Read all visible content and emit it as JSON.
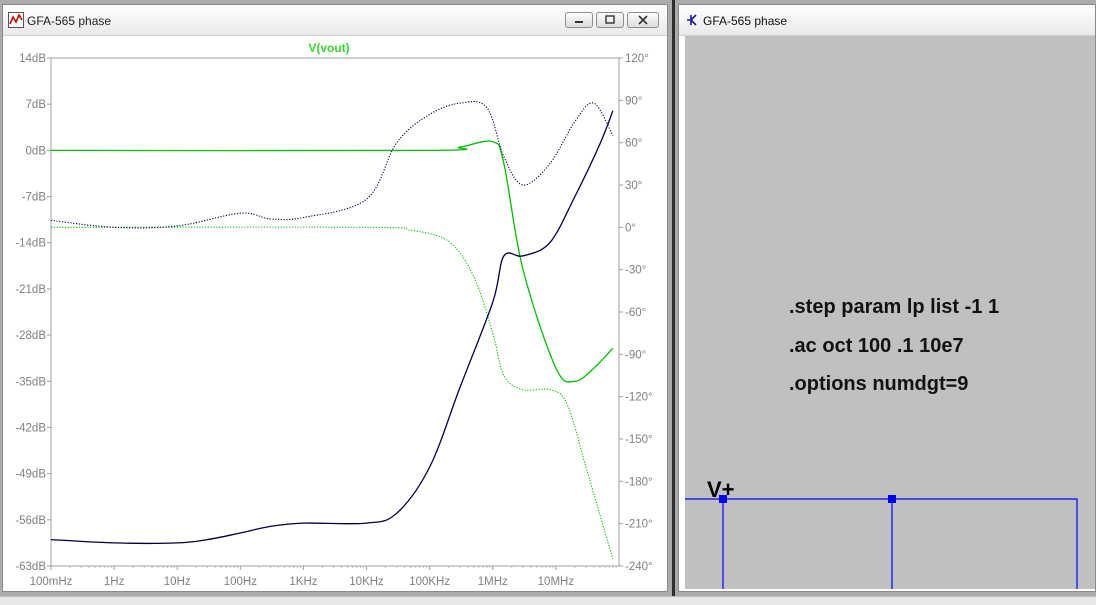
{
  "plot_window": {
    "title": "GFA-565 phase",
    "trace_label": "V(vout)",
    "icon": "waveform-plot-icon",
    "buttons": [
      "minimize-icon",
      "restore-icon",
      "close-icon"
    ]
  },
  "schematic_window": {
    "title": "GFA-565 phase",
    "icon": "schematic-icon",
    "directives": [
      ".step param lp list -1 1",
      ".ac oct 100 .1 10e7",
      ".options numdgt=9"
    ],
    "net_label": "V+"
  },
  "colors": {
    "green_trace": "#00c000",
    "dark_trace": "#000040",
    "axis_text": "#808080",
    "trace_label": "#33dd33",
    "schematic_bg": "#c0c0c0",
    "wire": "#0000ff"
  },
  "chart_data": {
    "type": "line",
    "title": "V(vout)",
    "x_scale": "log",
    "xlim": [
      0.1,
      100000000
    ],
    "x_ticks": [
      "100mHz",
      "1Hz",
      "10Hz",
      "100Hz",
      "1KHz",
      "10KHz",
      "100KHz",
      "1MHz",
      "10MHz"
    ],
    "y_left_ticks": [
      "14dB",
      "7dB",
      "0dB",
      "-7dB",
      "-14dB",
      "-21dB",
      "-28dB",
      "-35dB",
      "-42dB",
      "-49dB",
      "-56dB",
      "-63dB"
    ],
    "y_left_range": [
      -63,
      14
    ],
    "y_right_ticks": [
      "120°",
      "90°",
      "60°",
      "30°",
      "0°",
      "-30°",
      "-60°",
      "-90°",
      "-120°",
      "-150°",
      "-180°",
      "-210°",
      "-240°"
    ],
    "y_right_range": [
      -240,
      120
    ],
    "grid": false,
    "series": [
      {
        "axis": "left",
        "color": "#00c000",
        "style": "solid",
        "points": [
          [
            0.1,
            0
          ],
          [
            100000,
            0
          ],
          [
            300000,
            0.5
          ],
          [
            1000000,
            1.3
          ],
          [
            1500000,
            -2
          ],
          [
            3000000,
            -18
          ],
          [
            10000000,
            -33
          ],
          [
            20000000,
            -35
          ],
          [
            40000000,
            -33
          ],
          [
            80000000,
            -30
          ]
        ]
      },
      {
        "axis": "right",
        "color": "#00c000",
        "style": "dotted",
        "points": [
          [
            0.1,
            0
          ],
          [
            10000,
            0
          ],
          [
            50000,
            -2
          ],
          [
            200000,
            -10
          ],
          [
            500000,
            -35
          ],
          [
            1000000,
            -75
          ],
          [
            1500000,
            -105
          ],
          [
            3000000,
            -115
          ],
          [
            8000000,
            -115
          ],
          [
            15000000,
            -125
          ],
          [
            30000000,
            -170
          ],
          [
            80000000,
            -235
          ]
        ]
      },
      {
        "axis": "left",
        "color": "#000040",
        "style": "solid",
        "points": [
          [
            0.1,
            -59
          ],
          [
            1,
            -59.5
          ],
          [
            10,
            -59.5
          ],
          [
            30,
            -59
          ],
          [
            100,
            -58
          ],
          [
            300,
            -57
          ],
          [
            1000,
            -56.5
          ],
          [
            10000,
            -56.5
          ],
          [
            30000,
            -55
          ],
          [
            100000,
            -48
          ],
          [
            300000,
            -36
          ],
          [
            1000000,
            -23
          ],
          [
            1500000,
            -16
          ],
          [
            3000000,
            -16
          ],
          [
            8000000,
            -14
          ],
          [
            20000000,
            -7
          ],
          [
            50000000,
            1
          ],
          [
            80000000,
            6
          ]
        ]
      },
      {
        "axis": "right",
        "color": "#000040",
        "style": "dotted",
        "points": [
          [
            0.1,
            5
          ],
          [
            1,
            0
          ],
          [
            10,
            1
          ],
          [
            100,
            10
          ],
          [
            300,
            6
          ],
          [
            1000,
            7
          ],
          [
            10000,
            20
          ],
          [
            30000,
            60
          ],
          [
            100000,
            80
          ],
          [
            300000,
            88
          ],
          [
            800000,
            85
          ],
          [
            1500000,
            50
          ],
          [
            3000000,
            30
          ],
          [
            8000000,
            45
          ],
          [
            20000000,
            75
          ],
          [
            40000000,
            88
          ],
          [
            80000000,
            65
          ]
        ]
      }
    ]
  }
}
